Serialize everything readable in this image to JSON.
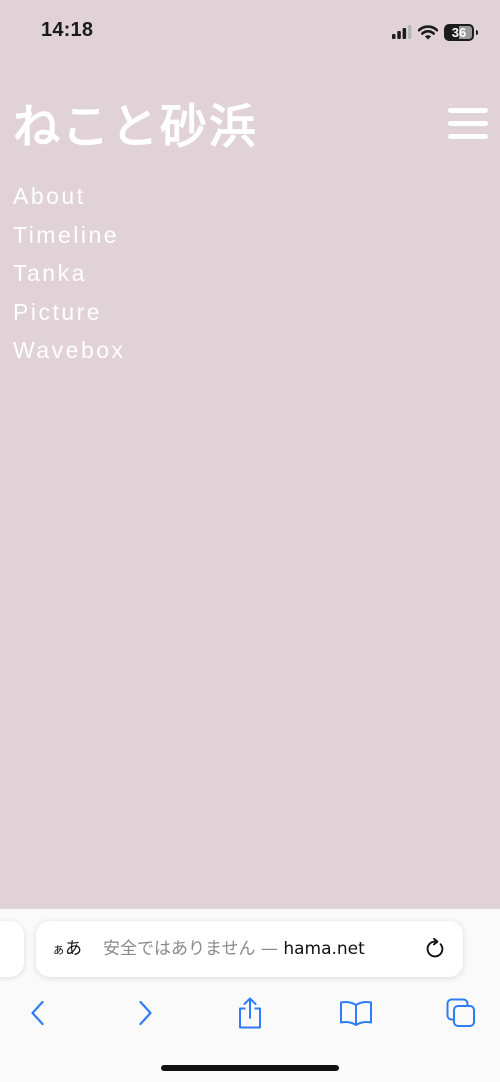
{
  "status_bar": {
    "time": "14:18",
    "battery_level": "36",
    "icons": [
      "cellular-signal-icon",
      "wifi-icon",
      "battery-icon"
    ]
  },
  "site": {
    "title": "ねこと砂浜",
    "nav": [
      "About",
      "Timeline",
      "Tanka",
      "Picture",
      "Wavebox"
    ]
  },
  "browser": {
    "text_size_button": {
      "small": "ぁ",
      "large": "あ"
    },
    "url_warning": "安全ではありません — ",
    "url_domain": "hama.net",
    "toolbar_icons": [
      "back-icon",
      "forward-icon",
      "share-icon",
      "bookmarks-icon",
      "tabs-icon"
    ]
  },
  "colors": {
    "page_background": "#e0d2d7",
    "accent_blue": "#2f7cf6",
    "text_light": "#ffffff"
  }
}
